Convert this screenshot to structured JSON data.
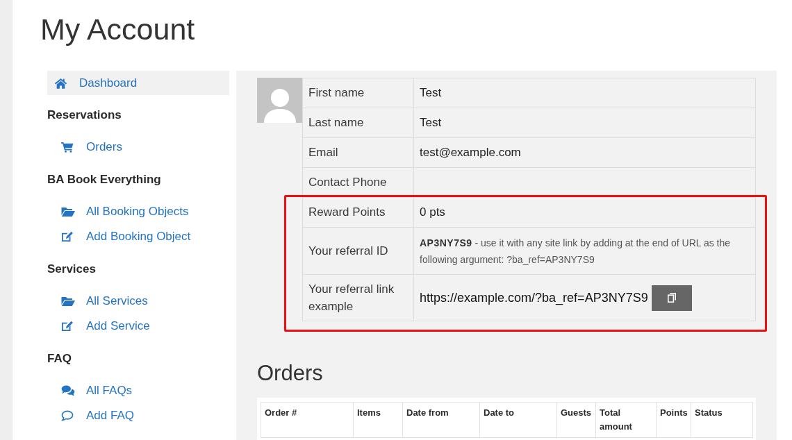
{
  "page": {
    "title": "My Account"
  },
  "sidebar": {
    "home": {
      "kind": "home",
      "label": "Dashboard",
      "selected": true
    },
    "sections": [
      {
        "heading": "Reservations",
        "items": [
          {
            "kind": "cart",
            "label": "Orders",
            "selected": false
          }
        ]
      },
      {
        "heading": "BA Book Everything",
        "items": [
          {
            "kind": "folder",
            "label": "All Booking Objects",
            "selected": false
          },
          {
            "kind": "edit",
            "label": "Add Booking Object",
            "selected": false
          }
        ]
      },
      {
        "heading": "Services",
        "items": [
          {
            "kind": "folder",
            "label": "All Services",
            "selected": false
          },
          {
            "kind": "edit",
            "label": "Add Service",
            "selected": false
          }
        ]
      },
      {
        "heading": "FAQ",
        "items": [
          {
            "kind": "comments",
            "label": "All FAQs",
            "selected": false
          },
          {
            "kind": "comment",
            "label": "Add FAQ",
            "selected": false
          }
        ]
      }
    ]
  },
  "profile": {
    "rows": [
      {
        "kind": "text",
        "label": "First name",
        "value": "Test",
        "highlighted": false
      },
      {
        "kind": "text",
        "label": "Last name",
        "value": "Test",
        "highlighted": false
      },
      {
        "kind": "text",
        "label": "Email",
        "value": "test@example.com",
        "highlighted": false
      },
      {
        "kind": "text",
        "label": "Contact Phone",
        "highlighted": false
      },
      {
        "kind": "text",
        "label": "Reward Points",
        "value": "0 pts",
        "highlighted": true
      },
      {
        "kind": "note",
        "label": "Your referral ID",
        "value": "**AP3NY7S9** - use it with any site link by adding at the end of URL as the following argument: ?ba_ref=AP3NY7S9",
        "highlighted": true
      },
      {
        "kind": "link",
        "label": "Your referral link example",
        "value": "https://example.com/?ba_ref=AP3NY7S9",
        "highlighted": true
      }
    ]
  },
  "orders": {
    "heading": "Orders",
    "table": {
      "columns": [
        "Order #",
        "Items",
        "Date from",
        "Date to",
        "Guests",
        "Total amount",
        "Points",
        "Status"
      ]
    }
  }
}
